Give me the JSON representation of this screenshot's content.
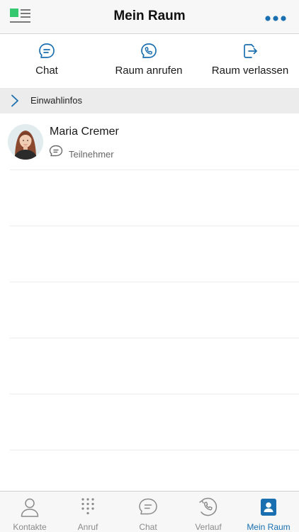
{
  "header": {
    "title": "Mein Raum",
    "menu_icon": "menu-icon",
    "more_icon": "more-icon"
  },
  "actions": [
    {
      "label": "Chat",
      "icon": "chat-icon"
    },
    {
      "label": "Raum anrufen",
      "icon": "phone-call-icon"
    },
    {
      "label": "Raum verlassen",
      "icon": "leave-room-icon"
    }
  ],
  "dialin": {
    "label": "Einwahlinfos",
    "icon": "chevron-right-icon"
  },
  "participants": [
    {
      "name": "Maria Cremer",
      "role": "Teilnehmer",
      "role_icon": "chat-icon"
    }
  ],
  "tabs": [
    {
      "label": "Kontakte",
      "icon": "person-icon",
      "active": false
    },
    {
      "label": "Anruf",
      "icon": "dialpad-icon",
      "active": false
    },
    {
      "label": "Chat",
      "icon": "chat-icon",
      "active": false
    },
    {
      "label": "Verlauf",
      "icon": "history-icon",
      "active": false
    },
    {
      "label": "Mein Raum",
      "icon": "my-room-icon",
      "active": true
    }
  ],
  "colors": {
    "accent": "#1a6fb0",
    "brand_green": "#35c86e",
    "inactive": "#8a8a8a"
  }
}
